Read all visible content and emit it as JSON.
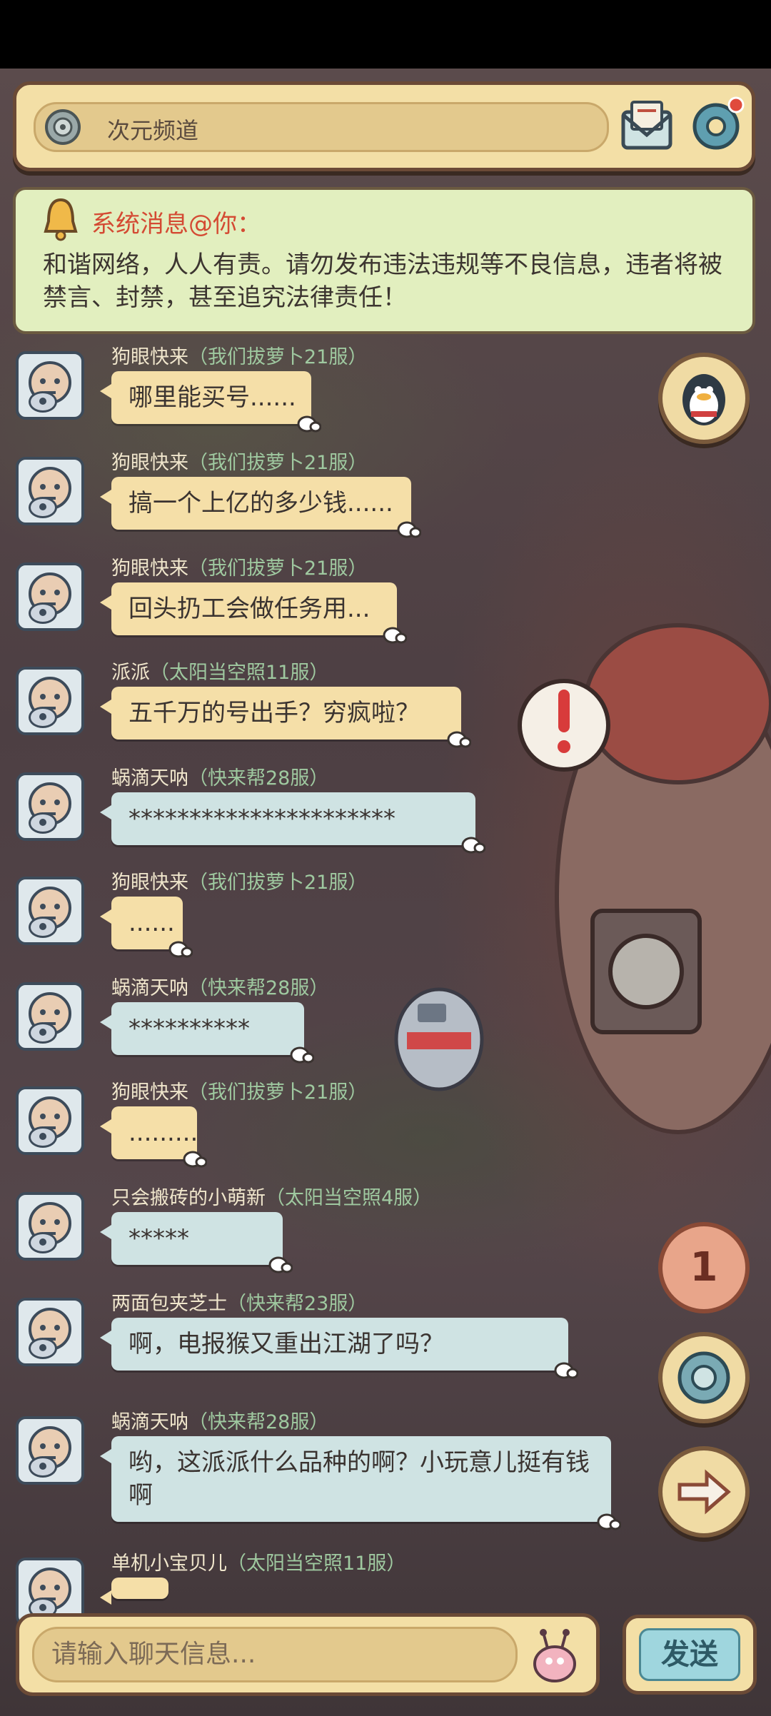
{
  "header": {
    "channel_name": "次元频道"
  },
  "notice": {
    "title": "系统消息@你：",
    "body": "和谐网络，人人有责。请勿发布违法违规等不良信息，违者将被禁言、封禁，甚至追究法律责任！"
  },
  "messages": [
    {
      "name": "狗眼快来",
      "server": "（我们拔萝卜21服）",
      "text": "哪里能买号......",
      "style": "tan"
    },
    {
      "name": "狗眼快来",
      "server": "（我们拔萝卜21服）",
      "text": "搞一个上亿的多少钱......",
      "style": "tan"
    },
    {
      "name": "狗眼快来",
      "server": "（我们拔萝卜21服）",
      "text": "回头扔工会做任务用...",
      "style": "tan"
    },
    {
      "name": "派派",
      "server": "（太阳当空照11服）",
      "text": "五千万的号出手？穷疯啦？",
      "style": "tan"
    },
    {
      "name": "蜗滴天呐",
      "server": "（快来帮28服）",
      "text": "**********************",
      "style": "blue"
    },
    {
      "name": "狗眼快来",
      "server": "（我们拔萝卜21服）",
      "text": "......",
      "style": "tan"
    },
    {
      "name": "蜗滴天呐",
      "server": "（快来帮28服）",
      "text": "**********",
      "style": "blue"
    },
    {
      "name": "狗眼快来",
      "server": "（我们拔萝卜21服）",
      "text": ".........",
      "style": "tan"
    },
    {
      "name": "只会搬砖的小萌新",
      "server": "（太阳当空照4服）",
      "text": "*****",
      "style": "blue"
    },
    {
      "name": "两面包夹芝士",
      "server": "（快来帮23服）",
      "text": "啊，电报猴又重出江湖了吗？",
      "style": "blue"
    },
    {
      "name": "蜗滴天呐",
      "server": "（快来帮28服）",
      "text": "哟，这派派什么品种的啊？小玩意儿挺有钱啊",
      "style": "blue"
    },
    {
      "name": "单机小宝贝儿",
      "server": "（太阳当空照11服）",
      "text": "",
      "style": "tan"
    }
  ],
  "side_buttons": {
    "unread_count": "1"
  },
  "input": {
    "placeholder": "请输入聊天信息...",
    "send_label": "发送"
  },
  "colors": {
    "accent_red": "#d44a33",
    "panel_tan": "#f3dfa6",
    "bubble_blue": "#cfe3e3"
  }
}
